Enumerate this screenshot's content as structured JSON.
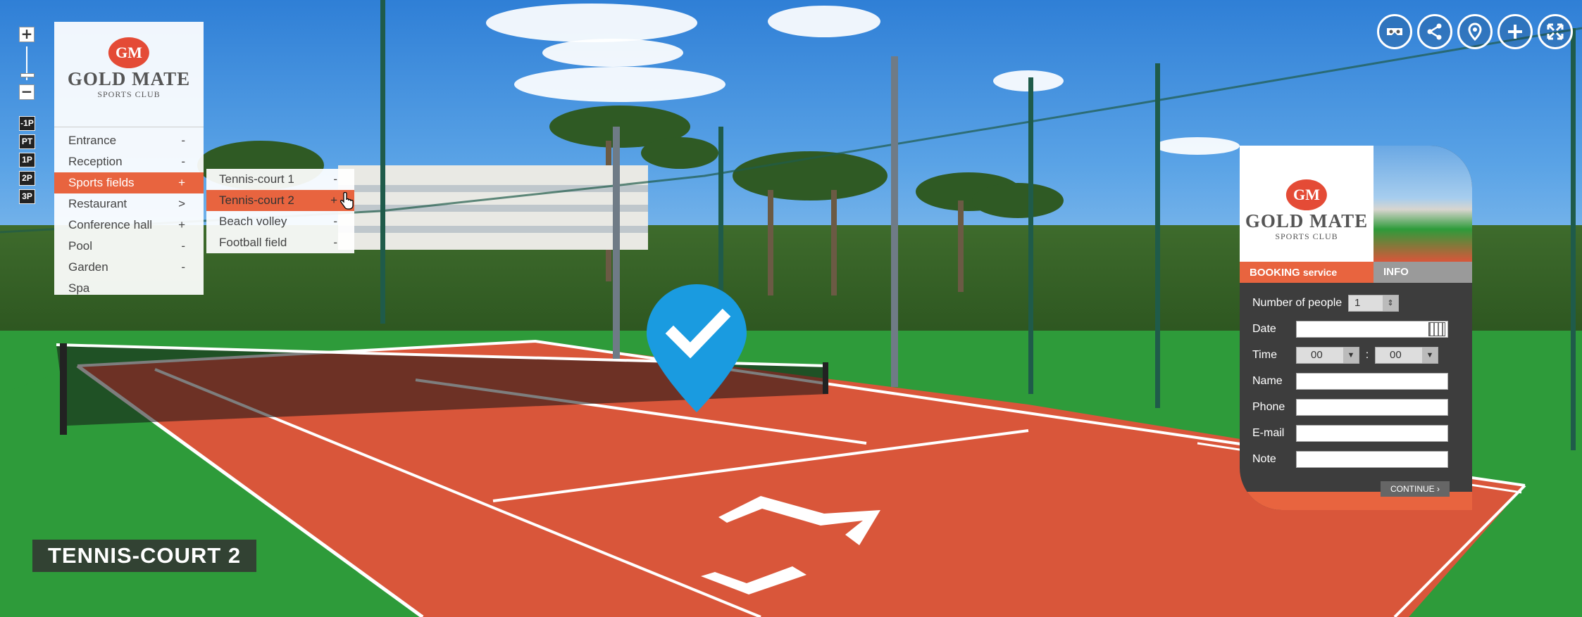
{
  "zoom": {
    "in_label": "+",
    "out_label": "−"
  },
  "floors": [
    "-1P",
    "PT",
    "1P",
    "2P",
    "3P"
  ],
  "menu": {
    "logo": {
      "initials": "GM",
      "name": "GOLD MATE",
      "subtitle": "SPORTS CLUB"
    },
    "items": [
      {
        "label": "Entrance",
        "marker": "-"
      },
      {
        "label": "Reception",
        "marker": "-"
      },
      {
        "label": "Sports fields",
        "marker": "+"
      },
      {
        "label": "Restaurant",
        "marker": ">"
      },
      {
        "label": "Conference hall",
        "marker": "+"
      },
      {
        "label": "Pool",
        "marker": "-"
      },
      {
        "label": "Garden",
        "marker": "-"
      },
      {
        "label": "Spa",
        "marker": ""
      }
    ],
    "active_index": 2
  },
  "submenu": {
    "items": [
      {
        "label": "Tennis-court 1",
        "marker": "-"
      },
      {
        "label": "Tennis-court 2",
        "marker": "+"
      },
      {
        "label": "Beach volley",
        "marker": "-"
      },
      {
        "label": "Football field",
        "marker": "-"
      }
    ],
    "active_index": 1
  },
  "top_icons": [
    "vr-headset-icon",
    "share-icon",
    "location-pin-icon",
    "add-icon",
    "fullscreen-icon"
  ],
  "booking": {
    "logo": {
      "initials": "GM",
      "name": "GOLD MATE",
      "subtitle": "SPORTS CLUB"
    },
    "tab_booking": "BOOKING",
    "tab_booking_suffix": "service",
    "tab_info": "INFO",
    "people_label": "Number of people",
    "people_value": "1",
    "date_label": "Date",
    "date_value": "",
    "time_label": "Time",
    "time_hour": "00",
    "time_minute": "00",
    "time_separator": ":",
    "name_label": "Name",
    "phone_label": "Phone",
    "email_label": "E-mail",
    "note_label": "Note",
    "continue_label": "CONTINUE"
  },
  "scene_title": "TENNIS-COURT 2",
  "colors": {
    "accent": "#e8643f",
    "pin": "#1a9be0",
    "panel": "#3d3d3d"
  }
}
